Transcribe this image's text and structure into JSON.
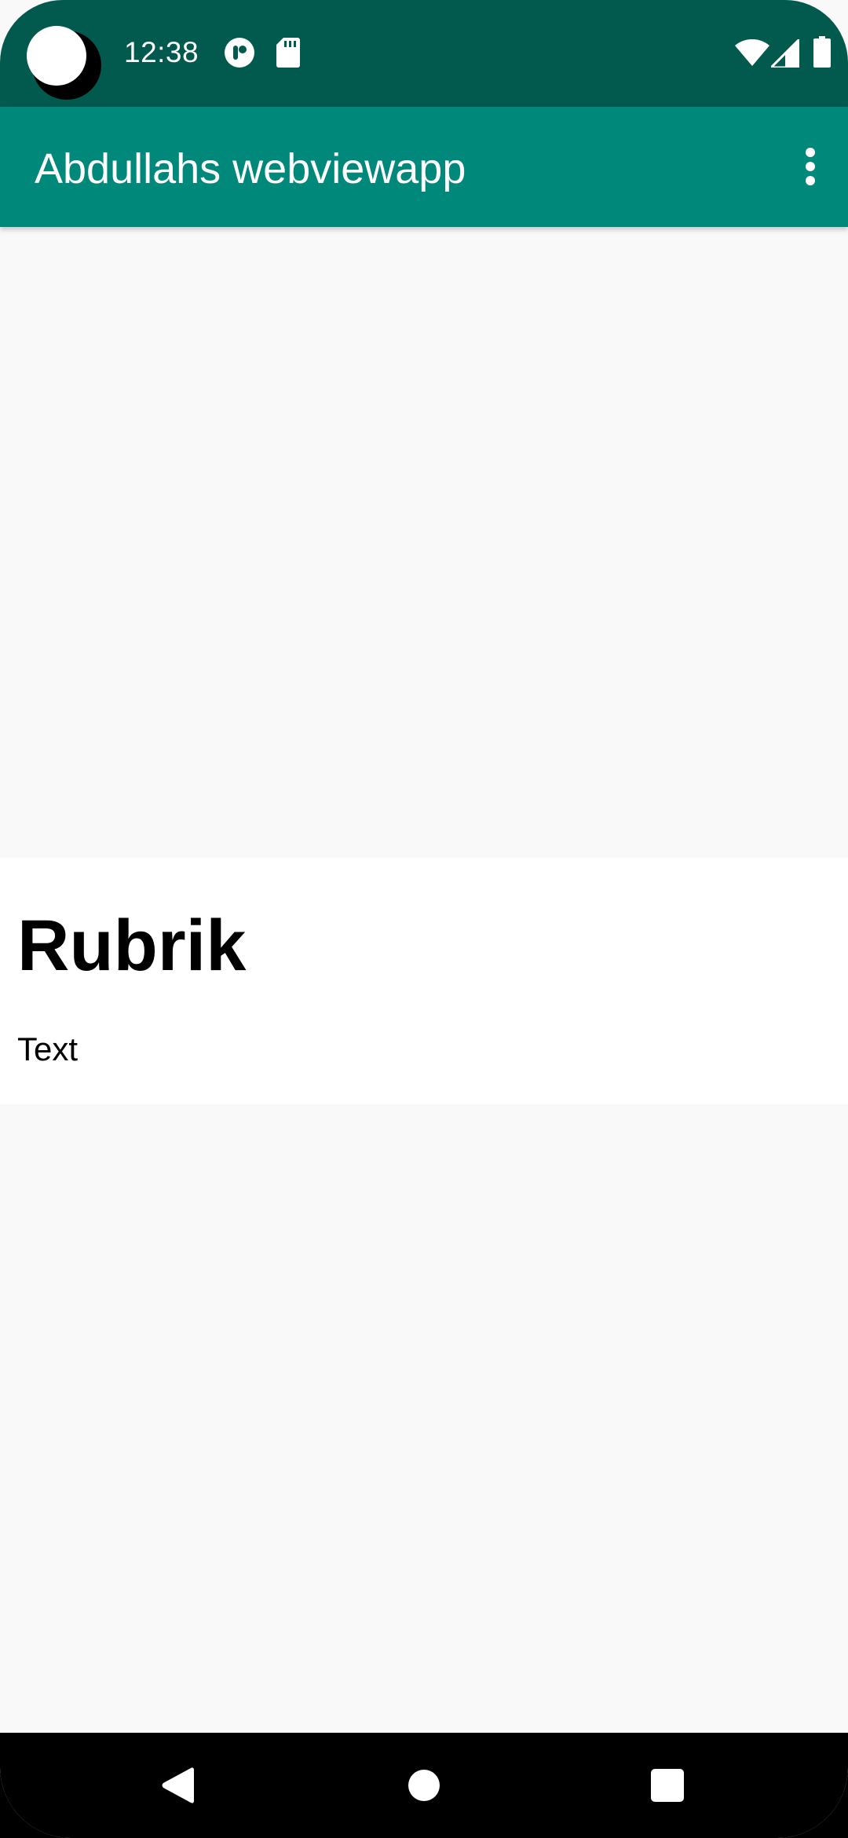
{
  "status_bar": {
    "time": "12:38",
    "notification_icons": [
      "app-notification-icon",
      "sd-card-icon"
    ],
    "system_icons": [
      "wifi-icon",
      "cellular-signal-icon",
      "battery-icon"
    ]
  },
  "app_bar": {
    "title": "Abdullahs webviewapp",
    "menu_icon": "overflow-menu-icon"
  },
  "webview": {
    "heading": "Rubrik",
    "text": "Text"
  },
  "nav_bar": {
    "buttons": [
      "back-icon",
      "home-icon",
      "recents-icon"
    ]
  },
  "colors": {
    "status_bar": "#02594d",
    "app_bar": "#00897b",
    "page_background": "#f9f9f9",
    "card_background": "#ffffff"
  }
}
